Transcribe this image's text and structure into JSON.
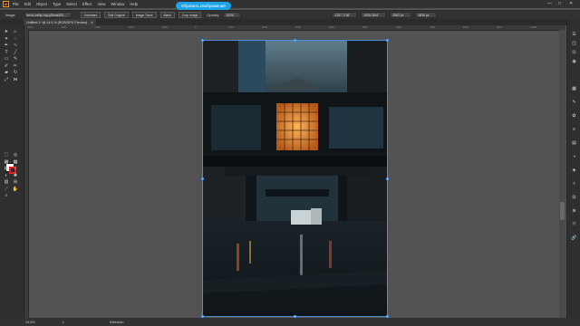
{
  "app": {
    "logo": "Ai",
    "menu": [
      "File",
      "Edit",
      "Object",
      "Type",
      "Select",
      "Effect",
      "View",
      "Window",
      "Help"
    ],
    "overlay_badge": "Обрезать изображение",
    "window_controls": [
      "—",
      "□",
      "✕"
    ]
  },
  "control_bar": {
    "object_type": "Image",
    "file_name": "kevin-vallty-HqLgSbmaWD...",
    "embed_label": "Unembed",
    "edit_original": "Edit Original",
    "image_trace": "Image Trace",
    "mask": "Mask",
    "crop_image": "Crop Image",
    "opacity_label": "Opacity:",
    "opacity_value": "100%",
    "x_value": "1257.7136",
    "y_value": "1995.2616",
    "w_value": "3563 px",
    "h_value": "4836 px"
  },
  "document_tab": {
    "title": "Untitled-1* @ 14.5 % (RGB/GPU Preview)",
    "close": "✕"
  },
  "ruler": {
    "ticks": [
      "-5000",
      "-4000",
      "-3000",
      "-2000",
      "-1000",
      "0",
      "1000",
      "2000",
      "3000",
      "4000",
      "5000",
      "6000",
      "7000",
      "8000",
      "9000",
      "10000"
    ]
  },
  "status_bar": {
    "zoom": "14.5%",
    "artboard": "1",
    "tool": "Selection"
  },
  "colors": {
    "accent": "#1fa3e8",
    "selection": "#4c8dd6",
    "ui_dark": "#323232",
    "canvas": "#535353"
  },
  "tools": [
    "selection-icon",
    "direct-selection-icon",
    "magic-wand-icon",
    "lasso-icon",
    "pen-icon",
    "curvature-icon",
    "type-icon",
    "line-icon",
    "rectangle-icon",
    "paintbrush-icon",
    "shaper-icon",
    "pencil-icon",
    "eraser-icon",
    "rotate-icon",
    "scale-icon",
    "width-icon",
    "free-transform-icon",
    "shape-builder-icon",
    "perspective-icon",
    "mesh-icon",
    "gradient-icon",
    "eyedropper-icon",
    "blend-icon",
    "symbol-sprayer-icon",
    "graph-icon",
    "artboard-icon",
    "slice-icon",
    "hand-icon",
    "zoom-icon"
  ],
  "right_icons": [
    "properties-icon",
    "layers-icon",
    "libraries-icon",
    "color-icon",
    "swatches-icon",
    "brushes-icon",
    "symbols-icon",
    "stroke-icon",
    "gradient-panel-icon",
    "transparency-icon",
    "appearance-icon",
    "graphic-styles-icon",
    "align-icon",
    "pathfinder-icon",
    "transform-icon",
    "links-icon"
  ]
}
